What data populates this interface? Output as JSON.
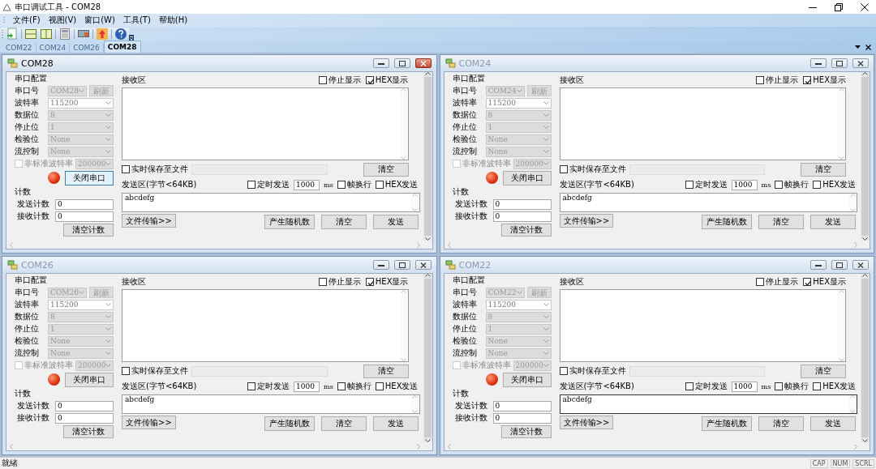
{
  "window": {
    "title": "串口调试工具 - COM28"
  },
  "menu": [
    "文件(F)",
    "视图(V)",
    "窗口(W)",
    "工具(T)",
    "帮助(H)"
  ],
  "tabs": [
    {
      "label": "COM22",
      "selected": false
    },
    {
      "label": "COM24",
      "selected": false
    },
    {
      "label": "COM26",
      "selected": false
    },
    {
      "label": "COM28",
      "selected": true
    }
  ],
  "panels": [
    {
      "title": "COM28",
      "active": true,
      "config_label": "串口配置",
      "settings": [
        {
          "label": "串口号",
          "value": "COM28",
          "disabled": true
        },
        {
          "label": "波特率",
          "value": "115200",
          "disabled": false
        },
        {
          "label": "数据位",
          "value": "8",
          "disabled": true
        },
        {
          "label": "停止位",
          "value": "1",
          "disabled": true
        },
        {
          "label": "检验位",
          "value": "None",
          "disabled": true
        },
        {
          "label": "流控制",
          "value": "None",
          "disabled": true
        }
      ],
      "refresh_button": {
        "label": "刷新",
        "disabled": true
      },
      "custom_baud": {
        "label": "非标准波特率",
        "checked": false,
        "value": "200000"
      },
      "port_open": true,
      "port_button": "关闭串口",
      "count": {
        "label": "计数",
        "send_label": "发送计数",
        "send_value": "0",
        "receive_label": "接收计数",
        "receive_value": "0",
        "clear_button": "清空计数"
      },
      "receive": {
        "label": "接收区",
        "stop_display": {
          "label": "停止显示",
          "checked": false
        },
        "hex_display": {
          "label": "HEX显示",
          "checked": true
        }
      },
      "save_to_file": {
        "label": "实时保存至文件",
        "checked": false
      },
      "clear_receive_button": "清空",
      "send": {
        "label": "发送区(字节<64KB)",
        "timed": {
          "label": "定时发送",
          "checked": false
        },
        "interval": "1000",
        "unit": "ms",
        "frame_newline": {
          "label": "帧换行",
          "checked": false
        },
        "hex_send": {
          "label": "HEX发送",
          "checked": false
        },
        "text": "abcdefg",
        "focused": false
      },
      "buttons": {
        "file_transfer": "文件传输>>",
        "random": "产生随机数",
        "clear": "清空",
        "send": "发送"
      }
    },
    {
      "title": "COM24",
      "active": false,
      "config_label": "串口配置",
      "settings": [
        {
          "label": "串口号",
          "value": "COM24",
          "disabled": true
        },
        {
          "label": "波特率",
          "value": "115200",
          "disabled": false
        },
        {
          "label": "数据位",
          "value": "8",
          "disabled": true
        },
        {
          "label": "停止位",
          "value": "1",
          "disabled": true
        },
        {
          "label": "检验位",
          "value": "None",
          "disabled": true
        },
        {
          "label": "流控制",
          "value": "None",
          "disabled": true
        }
      ],
      "refresh_button": {
        "label": "刷新",
        "disabled": true
      },
      "custom_baud": {
        "label": "非标准波特率",
        "checked": false,
        "value": "200000"
      },
      "port_open": true,
      "port_button": "关闭串口",
      "count": {
        "label": "计数",
        "send_label": "发送计数",
        "send_value": "0",
        "receive_label": "接收计数",
        "receive_value": "0",
        "clear_button": "清空计数"
      },
      "receive": {
        "label": "接收区",
        "stop_display": {
          "label": "停止显示",
          "checked": false
        },
        "hex_display": {
          "label": "HEX显示",
          "checked": true
        }
      },
      "save_to_file": {
        "label": "实时保存至文件",
        "checked": false
      },
      "clear_receive_button": "清空",
      "send": {
        "label": "发送区(字节<64KB)",
        "timed": {
          "label": "定时发送",
          "checked": false
        },
        "interval": "1000",
        "unit": "ms",
        "frame_newline": {
          "label": "帧换行",
          "checked": false
        },
        "hex_send": {
          "label": "HEX发送",
          "checked": false
        },
        "text": "abcdefg",
        "focused": false
      },
      "buttons": {
        "file_transfer": "文件传输>>",
        "random": "产生随机数",
        "clear": "清空",
        "send": "发送"
      }
    },
    {
      "title": "COM26",
      "active": false,
      "config_label": "串口配置",
      "settings": [
        {
          "label": "串口号",
          "value": "COM26",
          "disabled": true
        },
        {
          "label": "波特率",
          "value": "115200",
          "disabled": false
        },
        {
          "label": "数据位",
          "value": "8",
          "disabled": true
        },
        {
          "label": "停止位",
          "value": "1",
          "disabled": true
        },
        {
          "label": "检验位",
          "value": "None",
          "disabled": true
        },
        {
          "label": "流控制",
          "value": "None",
          "disabled": true
        }
      ],
      "refresh_button": {
        "label": "刷新",
        "disabled": true
      },
      "custom_baud": {
        "label": "非标准波特率",
        "checked": false,
        "value": "200000"
      },
      "port_open": true,
      "port_button": "关闭串口",
      "count": {
        "label": "计数",
        "send_label": "发送计数",
        "send_value": "0",
        "receive_label": "接收计数",
        "receive_value": "0",
        "clear_button": "清空计数"
      },
      "receive": {
        "label": "接收区",
        "stop_display": {
          "label": "停止显示",
          "checked": false
        },
        "hex_display": {
          "label": "HEX显示",
          "checked": true
        }
      },
      "save_to_file": {
        "label": "实时保存至文件",
        "checked": false
      },
      "clear_receive_button": "清空",
      "send": {
        "label": "发送区(字节<64KB)",
        "timed": {
          "label": "定时发送",
          "checked": false
        },
        "interval": "1000",
        "unit": "ms",
        "frame_newline": {
          "label": "帧换行",
          "checked": false
        },
        "hex_send": {
          "label": "HEX发送",
          "checked": false
        },
        "text": "abcdefg",
        "focused": false
      },
      "buttons": {
        "file_transfer": "文件传输>>",
        "random": "产生随机数",
        "clear": "清空",
        "send": "发送"
      }
    },
    {
      "title": "COM22",
      "active": false,
      "config_label": "串口配置",
      "settings": [
        {
          "label": "串口号",
          "value": "COM22",
          "disabled": true
        },
        {
          "label": "波特率",
          "value": "115200",
          "disabled": false
        },
        {
          "label": "数据位",
          "value": "8",
          "disabled": true
        },
        {
          "label": "停止位",
          "value": "1",
          "disabled": true
        },
        {
          "label": "检验位",
          "value": "None",
          "disabled": true
        },
        {
          "label": "流控制",
          "value": "None",
          "disabled": true
        }
      ],
      "refresh_button": {
        "label": "刷新",
        "disabled": true
      },
      "custom_baud": {
        "label": "非标准波特率",
        "checked": false,
        "value": "200000"
      },
      "port_open": true,
      "port_button": "关闭串口",
      "count": {
        "label": "计数",
        "send_label": "发送计数",
        "send_value": "0",
        "receive_label": "接收计数",
        "receive_value": "0",
        "clear_button": "清空计数"
      },
      "receive": {
        "label": "接收区",
        "stop_display": {
          "label": "停止显示",
          "checked": false
        },
        "hex_display": {
          "label": "HEX显示",
          "checked": true
        }
      },
      "save_to_file": {
        "label": "实时保存至文件",
        "checked": false
      },
      "clear_receive_button": "清空",
      "send": {
        "label": "发送区(字节<64KB)",
        "timed": {
          "label": "定时发送",
          "checked": false
        },
        "interval": "1000",
        "unit": "ms",
        "frame_newline": {
          "label": "帧换行",
          "checked": false
        },
        "hex_send": {
          "label": "HEX发送",
          "checked": false
        },
        "text": "abcdefg",
        "focused": true
      },
      "buttons": {
        "file_transfer": "文件传输>>",
        "random": "产生随机数",
        "clear": "清空",
        "send": "发送"
      }
    }
  ],
  "status_bar": {
    "message": "就绪",
    "indicators": [
      "CAP",
      "NUM",
      "SCRL"
    ]
  }
}
